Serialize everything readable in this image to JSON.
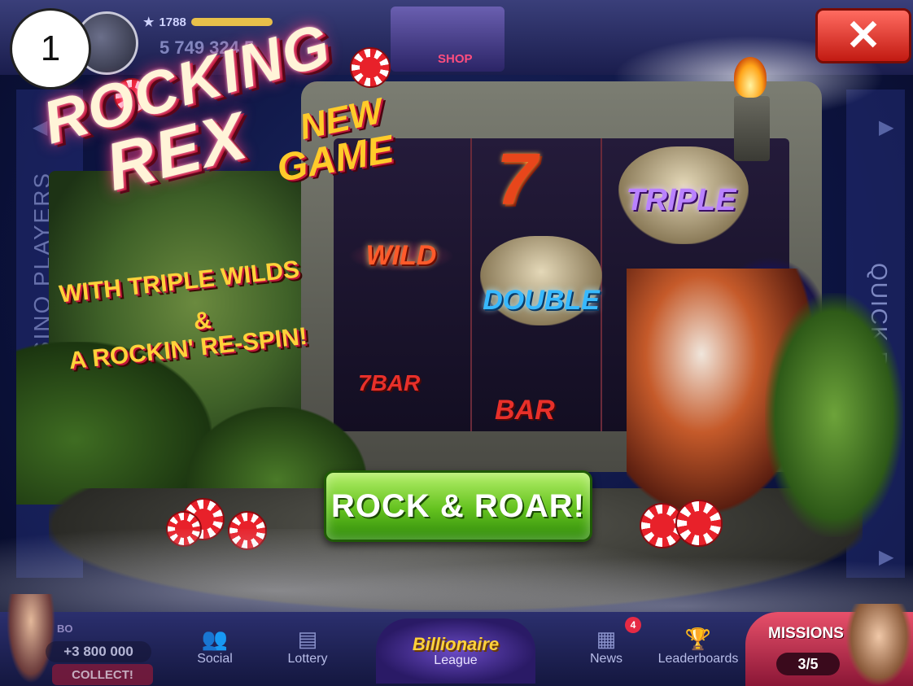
{
  "player": {
    "level": "1788",
    "coins": "5 749 324 5"
  },
  "top_bar": {
    "shop_label": "SHOP",
    "close_icon": "close-x-icon"
  },
  "step_badge": "1",
  "sidebar": {
    "left_label": "CASINO PLAYERS",
    "right_label": "QUICK PLAY"
  },
  "promo": {
    "title_line1": "ROCKING",
    "title_line2": "REX",
    "badge_line1": "NEW",
    "badge_line2": "GAME",
    "tagline_line1": "WITH TRIPLE WILDS",
    "tagline_line2": "&",
    "tagline_line3": "A ROCKIN' RE-SPIN!",
    "cta_label": "ROCK & ROAR!",
    "reel_symbols": {
      "seven": "7",
      "wild": "WILD",
      "double": "DOUBLE",
      "triple": "TRIPLE",
      "bar": "BAR",
      "bar7": "7BAR"
    }
  },
  "bottom_bar": {
    "bonus_label": "BO",
    "bonus_amount": "+3 800 000",
    "collect_label": "COLLECT!",
    "nav": [
      {
        "label": "Social",
        "icon": "social-icon"
      },
      {
        "label": "Lottery",
        "icon": "lottery-ticket-icon"
      },
      {
        "label": "News",
        "icon": "news-icon"
      },
      {
        "label": "Leaderboards",
        "icon": "trophy-icon"
      }
    ],
    "news_badge": "4",
    "league_line1": "Billionaire",
    "league_line2": "League",
    "missions_label": "MISSIONS",
    "missions_count": "3/5"
  },
  "colors": {
    "cta_green": "#63c11e",
    "close_red": "#e0281e",
    "title_pink": "#c2153a",
    "tagline_gold": "#ffd23a"
  }
}
